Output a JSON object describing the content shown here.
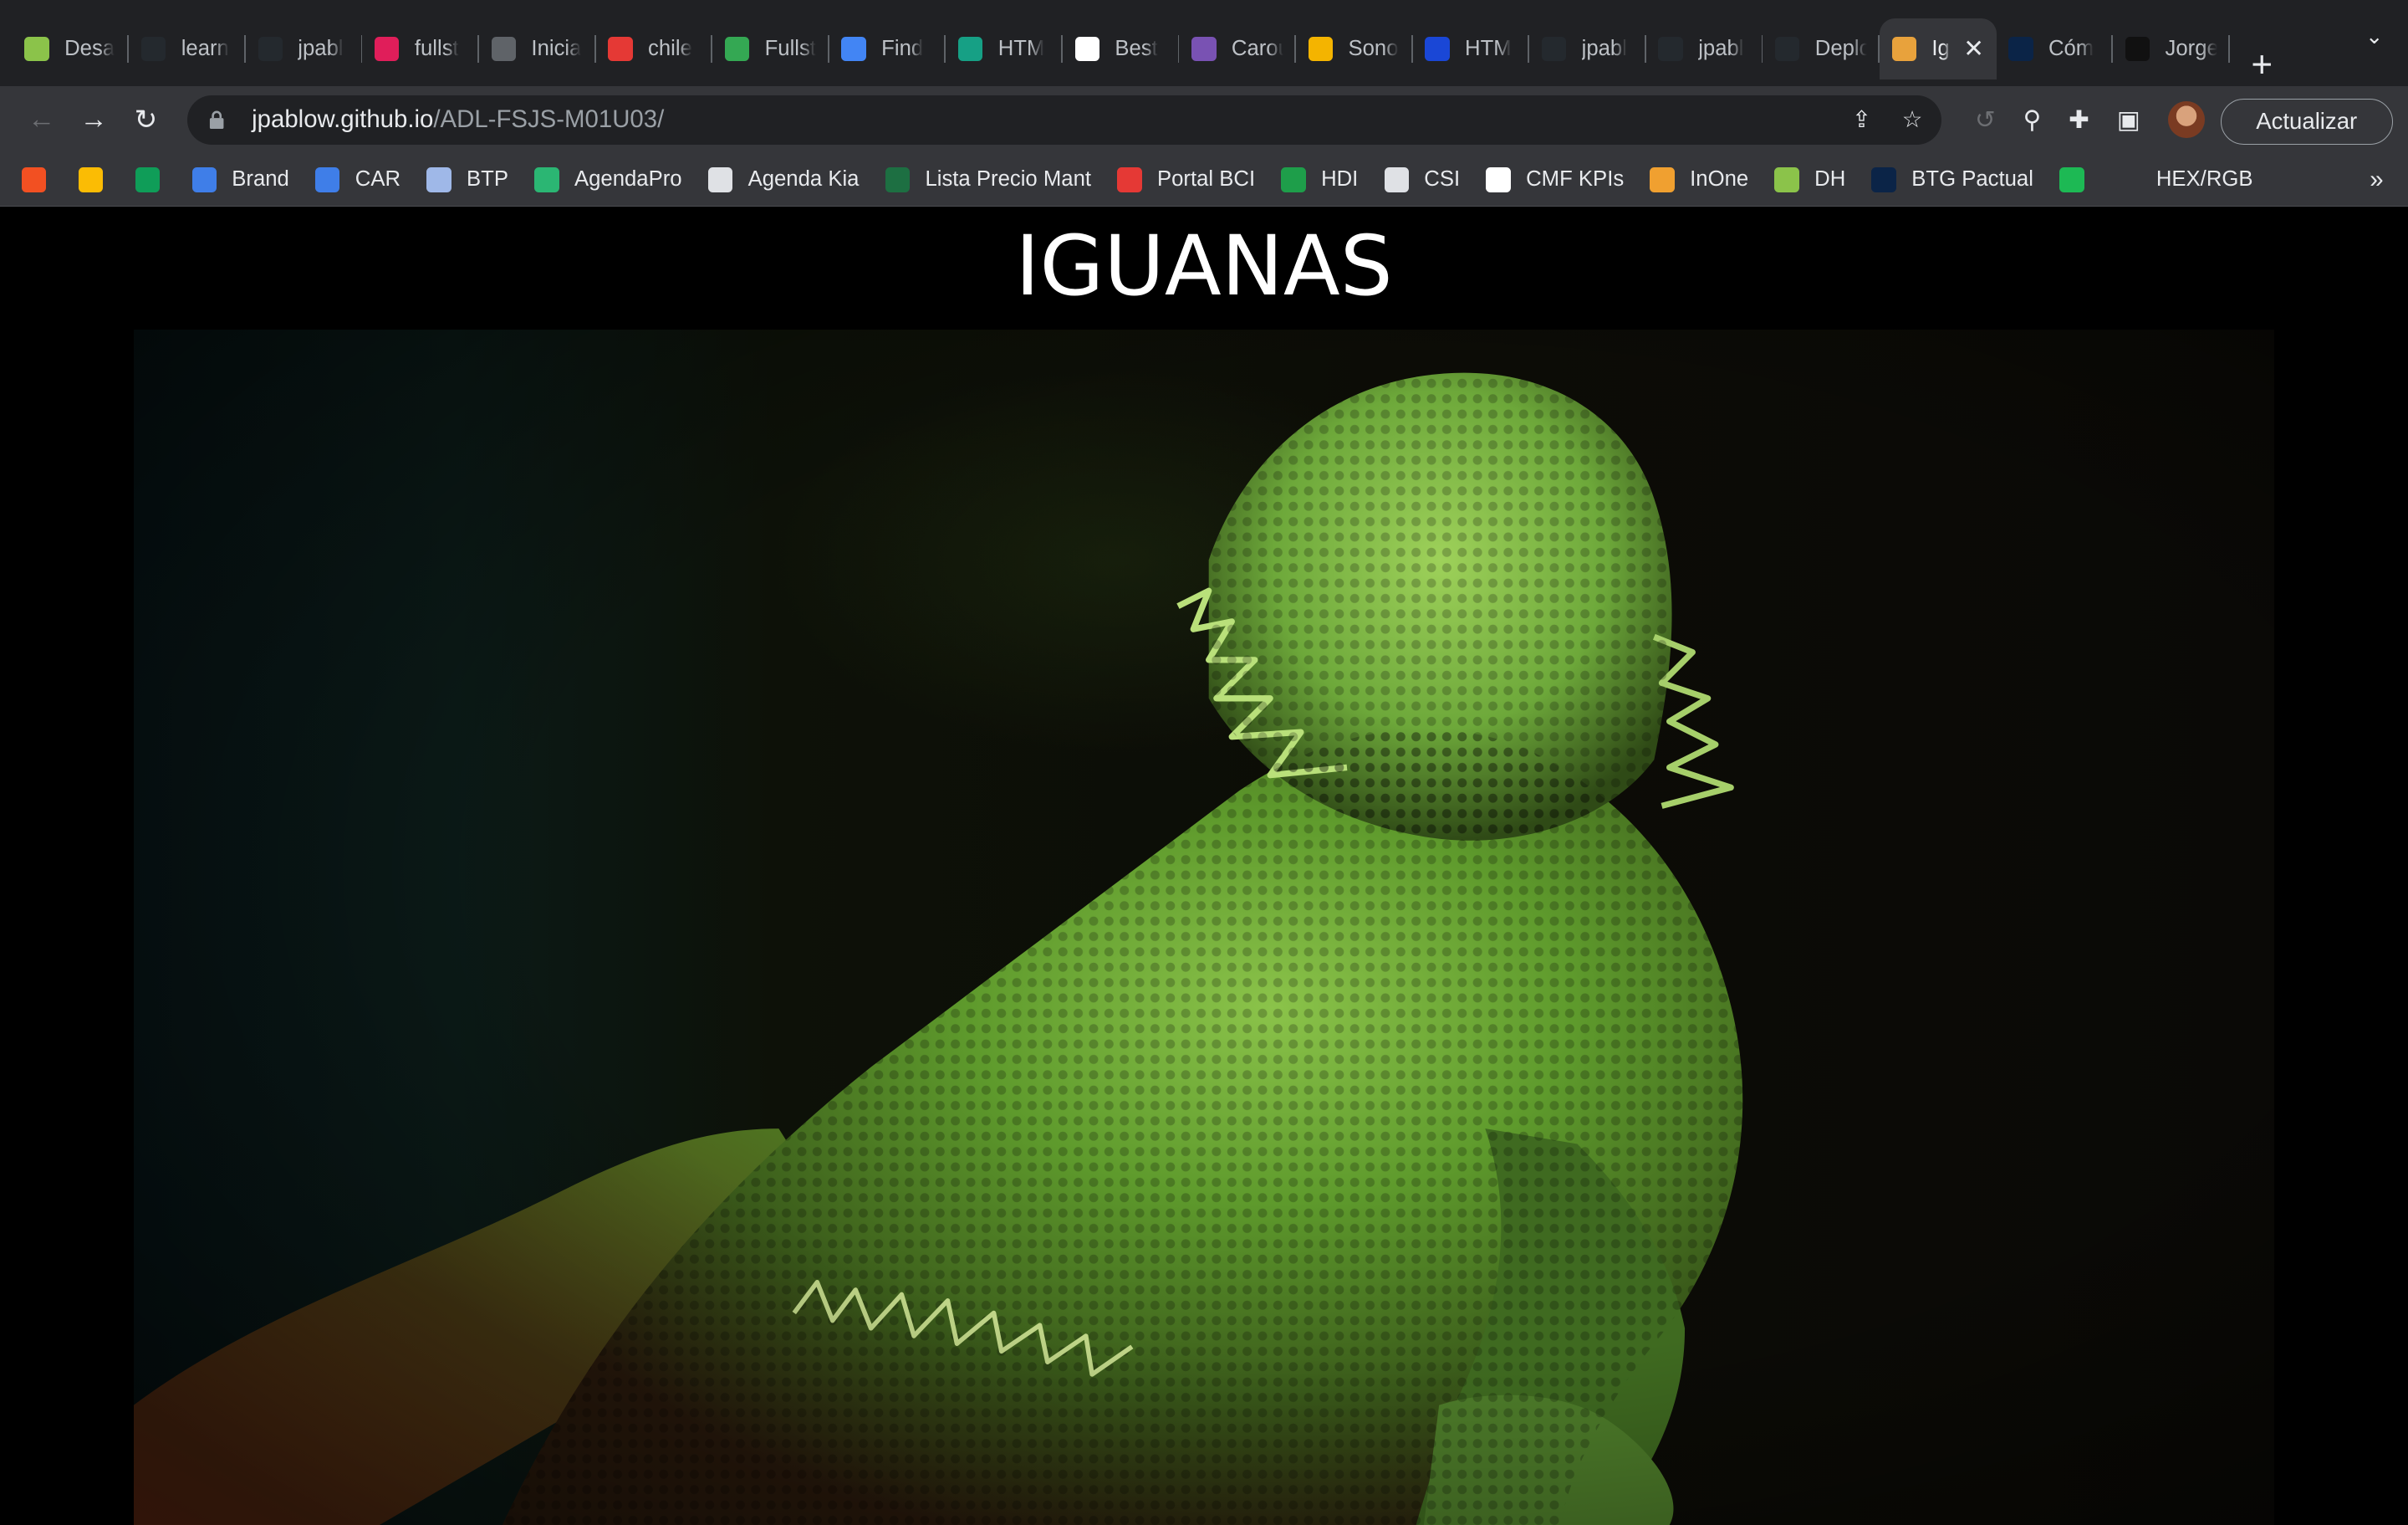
{
  "tabs": [
    {
      "label": "Desa",
      "icon": "braces-icon",
      "color": "#8bc34a"
    },
    {
      "label": "learn",
      "icon": "github-icon",
      "color": "#24292e"
    },
    {
      "label": "jpabl",
      "icon": "github-icon",
      "color": "#24292e"
    },
    {
      "label": "fullst",
      "icon": "slack-icon",
      "color": "#e01e5a"
    },
    {
      "label": "Inicia",
      "icon": "globe-icon",
      "color": "#5f6368"
    },
    {
      "label": "chile",
      "icon": "n-logo-icon",
      "color": "#e53935"
    },
    {
      "label": "Fullst",
      "icon": "drive-icon",
      "color": "#34a853"
    },
    {
      "label": "Find",
      "icon": "flag-icon",
      "color": "#4285f4"
    },
    {
      "label": "HTM",
      "icon": "w-logo-icon",
      "color": "#16a085"
    },
    {
      "label": "Best",
      "icon": "cb-logo-icon",
      "color": "#ffffff"
    },
    {
      "label": "Carou",
      "icon": "bootstrap-icon",
      "color": "#7952b3"
    },
    {
      "label": "Sono",
      "icon": "sono-icon",
      "color": "#f4b400"
    },
    {
      "label": "HTM",
      "icon": "docs-icon",
      "color": "#1a47d6"
    },
    {
      "label": "jpabl",
      "icon": "github-icon",
      "color": "#24292e"
    },
    {
      "label": "jpabl",
      "icon": "github-icon",
      "color": "#24292e"
    },
    {
      "label": "Deplo",
      "icon": "github-icon",
      "color": "#24292e"
    },
    {
      "label": "Ig",
      "icon": "lizard-icon",
      "color": "#e8a23c",
      "active": true
    },
    {
      "label": "Cóm",
      "icon": "hd-logo-icon",
      "color": "#0b2447"
    },
    {
      "label": "Jorge",
      "icon": "jr-logo-icon",
      "color": "#111111"
    }
  ],
  "toolbar": {
    "url_host": "jpablow.github.io",
    "url_path": "/ADL-FSJS-M01U03/",
    "update_label": "Actualizar"
  },
  "bookmarks": [
    {
      "label": "",
      "color": "#f25022"
    },
    {
      "label": "",
      "color": "#fbbc04"
    },
    {
      "label": "",
      "color": "#0f9d58"
    },
    {
      "label": "Brand",
      "color": "#3f7ee8"
    },
    {
      "label": "CAR",
      "color": "#3f7ee8"
    },
    {
      "label": "BTP",
      "color": "#9fb8e8"
    },
    {
      "label": "AgendaPro",
      "color": "#2bb673"
    },
    {
      "label": "Agenda Kia",
      "color": "#dfe1e5"
    },
    {
      "label": "Lista Precio Mant",
      "color": "#1d6f42"
    },
    {
      "label": "Portal BCI",
      "color": "#e53935"
    },
    {
      "label": "HDI",
      "color": "#1e9e4a"
    },
    {
      "label": "CSI",
      "color": "#dfe1e5"
    },
    {
      "label": "CMF KPIs",
      "color": "#ffffff"
    },
    {
      "label": "InOne",
      "color": "#f0a030"
    },
    {
      "label": "DH",
      "color": "#8bc34a"
    },
    {
      "label": "BTG Pactual",
      "color": "#0b2447"
    },
    {
      "label": "",
      "color": "#1db954"
    },
    {
      "label": "HEX/RGB",
      "color": "#35363a"
    }
  ],
  "page": {
    "title": "IGUANAS"
  },
  "colors": {
    "tab_strip": "#202124",
    "toolbar": "#35363a",
    "page_bg": "#000000",
    "iguana_green": "#6fa63a"
  }
}
